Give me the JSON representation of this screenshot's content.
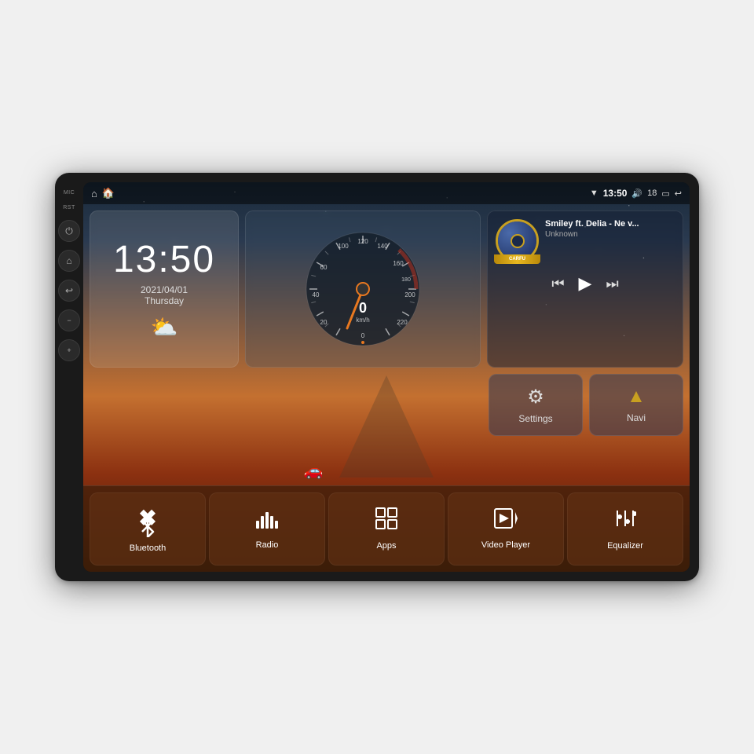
{
  "unit": {
    "side_labels": {
      "mic": "MIC",
      "rst": "RST"
    },
    "side_buttons": [
      {
        "name": "power-button",
        "icon": "⏻"
      },
      {
        "name": "home-button",
        "icon": "⌂"
      },
      {
        "name": "back-button",
        "icon": "↩"
      },
      {
        "name": "vol-down-button",
        "icon": "🔉"
      },
      {
        "name": "vol-up-button",
        "icon": "🔊"
      }
    ]
  },
  "status_bar": {
    "home_icon": "⌂",
    "map_icon": "🏠",
    "wifi_icon": "▼",
    "time": "13:50",
    "volume_icon": "🔊",
    "volume_level": "18",
    "battery_icon": "▭",
    "back_icon": "↩"
  },
  "clock_widget": {
    "time": "13:50",
    "date": "2021/04/01",
    "day": "Thursday",
    "weather_icon": "⛅"
  },
  "music_widget": {
    "title": "Smiley ft. Delia - Ne v...",
    "artist": "Unknown",
    "prev_icon": "⏮",
    "play_icon": "▶",
    "next_icon": "⏭"
  },
  "quick_buttons": [
    {
      "name": "settings-button",
      "icon": "⚙",
      "label": "Settings"
    },
    {
      "name": "navi-button",
      "icon": "◬",
      "label": "Navi"
    }
  ],
  "bottom_buttons": [
    {
      "name": "bluetooth-button",
      "icon": "✦",
      "label": "Bluetooth"
    },
    {
      "name": "radio-button",
      "icon": "📶",
      "label": "Radio"
    },
    {
      "name": "apps-button",
      "icon": "⊞",
      "label": "Apps"
    },
    {
      "name": "video-player-button",
      "icon": "▶",
      "label": "Video Player"
    },
    {
      "name": "equalizer-button",
      "icon": "⚡",
      "label": "Equalizer"
    }
  ],
  "speedo": {
    "value": "0",
    "unit": "km/h",
    "max": "240"
  }
}
